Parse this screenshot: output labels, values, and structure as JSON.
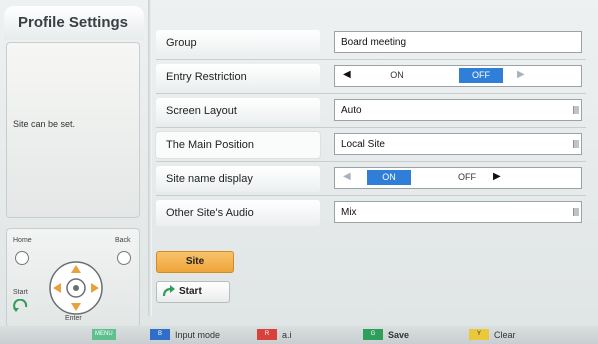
{
  "left_panel": {
    "title": "Profile Settings",
    "info_text": "Site can be set."
  },
  "remote": {
    "home_label": "Home",
    "back_label": "Back",
    "start_label": "Start",
    "enter_label": "Enter"
  },
  "settings": {
    "group": {
      "label": "Group",
      "value": "Board meeting"
    },
    "entry_restriction": {
      "label": "Entry Restriction",
      "on": "ON",
      "off": "OFF",
      "selected": "OFF"
    },
    "screen_layout": {
      "label": "Screen Layout",
      "value": "Auto"
    },
    "main_position": {
      "label": "The Main Position",
      "value": "Local Site"
    },
    "site_name_display": {
      "label": "Site name display",
      "on": "ON",
      "off": "OFF",
      "selected": "ON"
    },
    "other_site_audio": {
      "label": "Other Site's Audio",
      "value": "Mix"
    }
  },
  "buttons": {
    "site": "Site",
    "start": "Start"
  },
  "footer": {
    "menu_key": "MENU",
    "input_mode_key": "B",
    "input_mode": "Input mode",
    "ai_key": "R",
    "ai": "a.i",
    "save_key": "G",
    "save": "Save",
    "clear_key": "Y",
    "clear": "Clear"
  },
  "colors": {
    "site_button": "#f0a93f",
    "toggle_active": "#2f7fd8",
    "menu_key": "#5fbf8f",
    "blue_key": "#2f6fc8",
    "red_key": "#d9423a",
    "green_key": "#2e9e5b",
    "yellow_key": "#e9c93a"
  }
}
